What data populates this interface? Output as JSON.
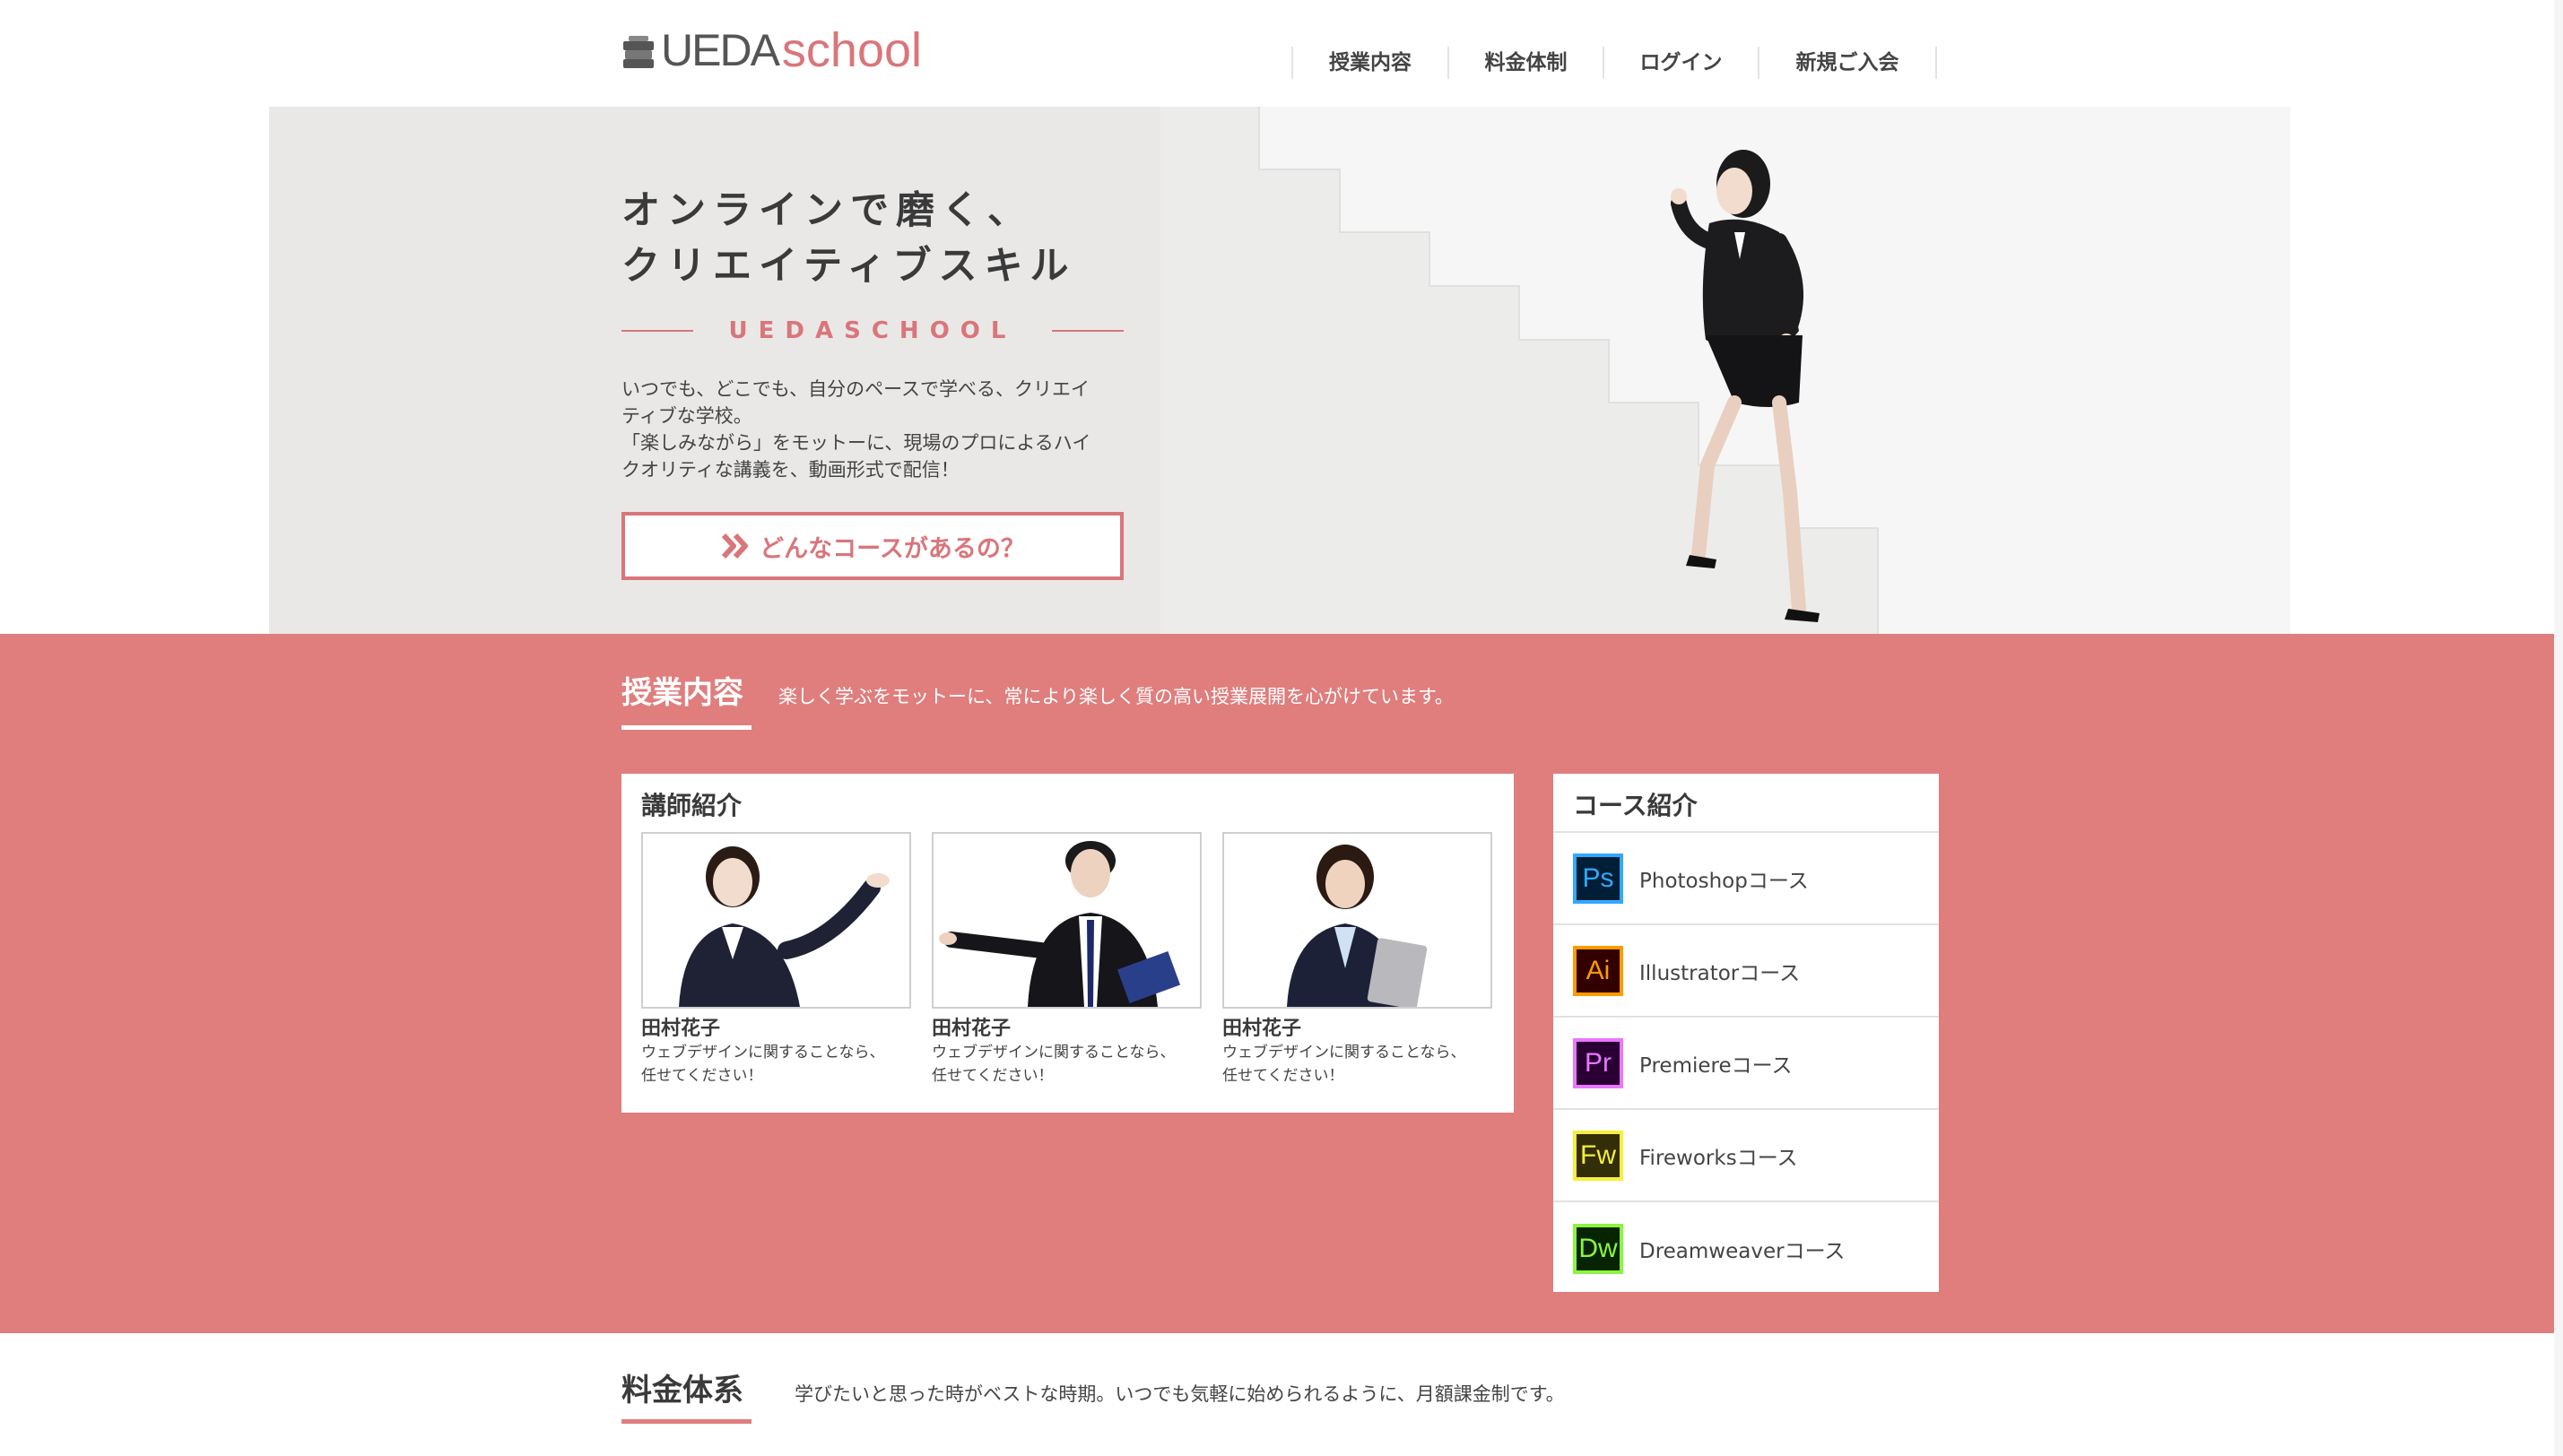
{
  "logo": {
    "part1": "UEDA",
    "part2": "school"
  },
  "nav": {
    "items": [
      "授業内容",
      "料金体制",
      "ログイン",
      "新規ご入会"
    ]
  },
  "hero": {
    "title_line1": "オンラインで磨く、",
    "title_line2": "クリエイティブスキル",
    "brand": "UEDASCHOOL",
    "desc_line1": "いつでも、どこでも、自分のペースで学べる、クリエイ",
    "desc_line2": "ティブな学校。",
    "desc_line3": "「楽しみながら」をモットーに、現場のプロによるハイ",
    "desc_line4": "クオリティな講義を、動画形式で配信！",
    "button": "どんなコースがあるの？"
  },
  "classes": {
    "title": "授業内容",
    "subtitle": "楽しく学ぶをモットーに、常により楽しく質の高い授業展開を心がけています。",
    "teachers_title": "講師紹介",
    "teachers": [
      {
        "name": "田村花子",
        "desc1": "ウェブデザインに関することなら、",
        "desc2": "任せてください！"
      },
      {
        "name": "田村花子",
        "desc1": "ウェブデザインに関することなら、",
        "desc2": "任せてください！"
      },
      {
        "name": "田村花子",
        "desc1": "ウェブデザインに関することなら、",
        "desc2": "任せてください！"
      }
    ],
    "courses_title": "コース紹介",
    "courses": [
      {
        "icon": "Ps",
        "label": "Photoshopコース",
        "fg": "#31a8ff",
        "bg": "#001e36"
      },
      {
        "icon": "Ai",
        "label": "Illustratorコース",
        "fg": "#ff9a00",
        "bg": "#330000"
      },
      {
        "icon": "Pr",
        "label": "Premiereコース",
        "fg": "#ea77ff",
        "bg": "#2a0034"
      },
      {
        "icon": "Fw",
        "label": "Fireworksコース",
        "fg": "#f7ee3b",
        "bg": "#332e07"
      },
      {
        "icon": "Dw",
        "label": "Dreamweaverコース",
        "fg": "#8bf440",
        "bg": "#072401"
      }
    ]
  },
  "pricing": {
    "title": "料金体系",
    "subtitle": "学びたいと思った時がベストな時期。いつでも気軽に始められるように、月額課金制です。"
  },
  "colors": {
    "accent": "#df7e7d",
    "brand": "#d9767a",
    "text": "#444444"
  }
}
